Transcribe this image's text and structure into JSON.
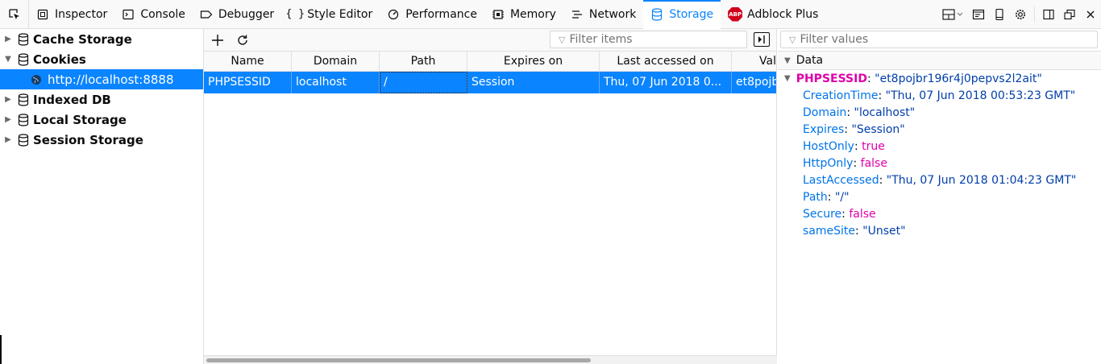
{
  "toolbar": {
    "tabs": [
      {
        "label": "Inspector",
        "icon": "inspector-icon"
      },
      {
        "label": "Console",
        "icon": "console-icon"
      },
      {
        "label": "Debugger",
        "icon": "debugger-icon"
      },
      {
        "label": "Style Editor",
        "icon": "style-editor-icon"
      },
      {
        "label": "Performance",
        "icon": "performance-icon"
      },
      {
        "label": "Memory",
        "icon": "memory-icon"
      },
      {
        "label": "Network",
        "icon": "network-icon"
      },
      {
        "label": "Storage",
        "icon": "storage-icon"
      },
      {
        "label": "Adblock Plus",
        "icon": "adblock-plus-icon",
        "badge": "ABP"
      }
    ],
    "selected": "Storage",
    "accent_color": "#0a84ff"
  },
  "tree": {
    "items": [
      {
        "label": "Cache Storage",
        "expanded": false
      },
      {
        "label": "Cookies",
        "expanded": true
      },
      {
        "label": "http://localhost:8888",
        "child": true,
        "selected": true
      },
      {
        "label": "Indexed DB",
        "expanded": false
      },
      {
        "label": "Local Storage",
        "expanded": false
      },
      {
        "label": "Session Storage",
        "expanded": false
      }
    ]
  },
  "table": {
    "filter_placeholder": "Filter items",
    "columns": [
      "Name",
      "Domain",
      "Path",
      "Expires on",
      "Last accessed on",
      "Val"
    ],
    "rows": [
      [
        "PHPSESSID",
        "localhost",
        "/",
        "Session",
        "Thu, 07 Jun 2018 0...",
        "et8pojb"
      ]
    ]
  },
  "sidebar": {
    "filter_placeholder": "Filter values",
    "section_title": "Data",
    "root_name": "PHPSESSID",
    "root_value": "\"et8pojbr196r4j0pepvs2l2ait\"",
    "properties": [
      {
        "key": "CreationTime",
        "value": "\"Thu, 07 Jun 2018 00:53:23 GMT\"",
        "kind": "string"
      },
      {
        "key": "Domain",
        "value": "\"localhost\"",
        "kind": "string"
      },
      {
        "key": "Expires",
        "value": "\"Session\"",
        "kind": "string"
      },
      {
        "key": "HostOnly",
        "value": "true",
        "kind": "bool"
      },
      {
        "key": "HttpOnly",
        "value": "false",
        "kind": "bool"
      },
      {
        "key": "LastAccessed",
        "value": "\"Thu, 07 Jun 2018 01:04:23 GMT\"",
        "kind": "string"
      },
      {
        "key": "Path",
        "value": "\"/\"",
        "kind": "string"
      },
      {
        "key": "Secure",
        "value": "false",
        "kind": "bool"
      },
      {
        "key": "sameSite",
        "value": "\"Unset\"",
        "kind": "string"
      }
    ]
  }
}
